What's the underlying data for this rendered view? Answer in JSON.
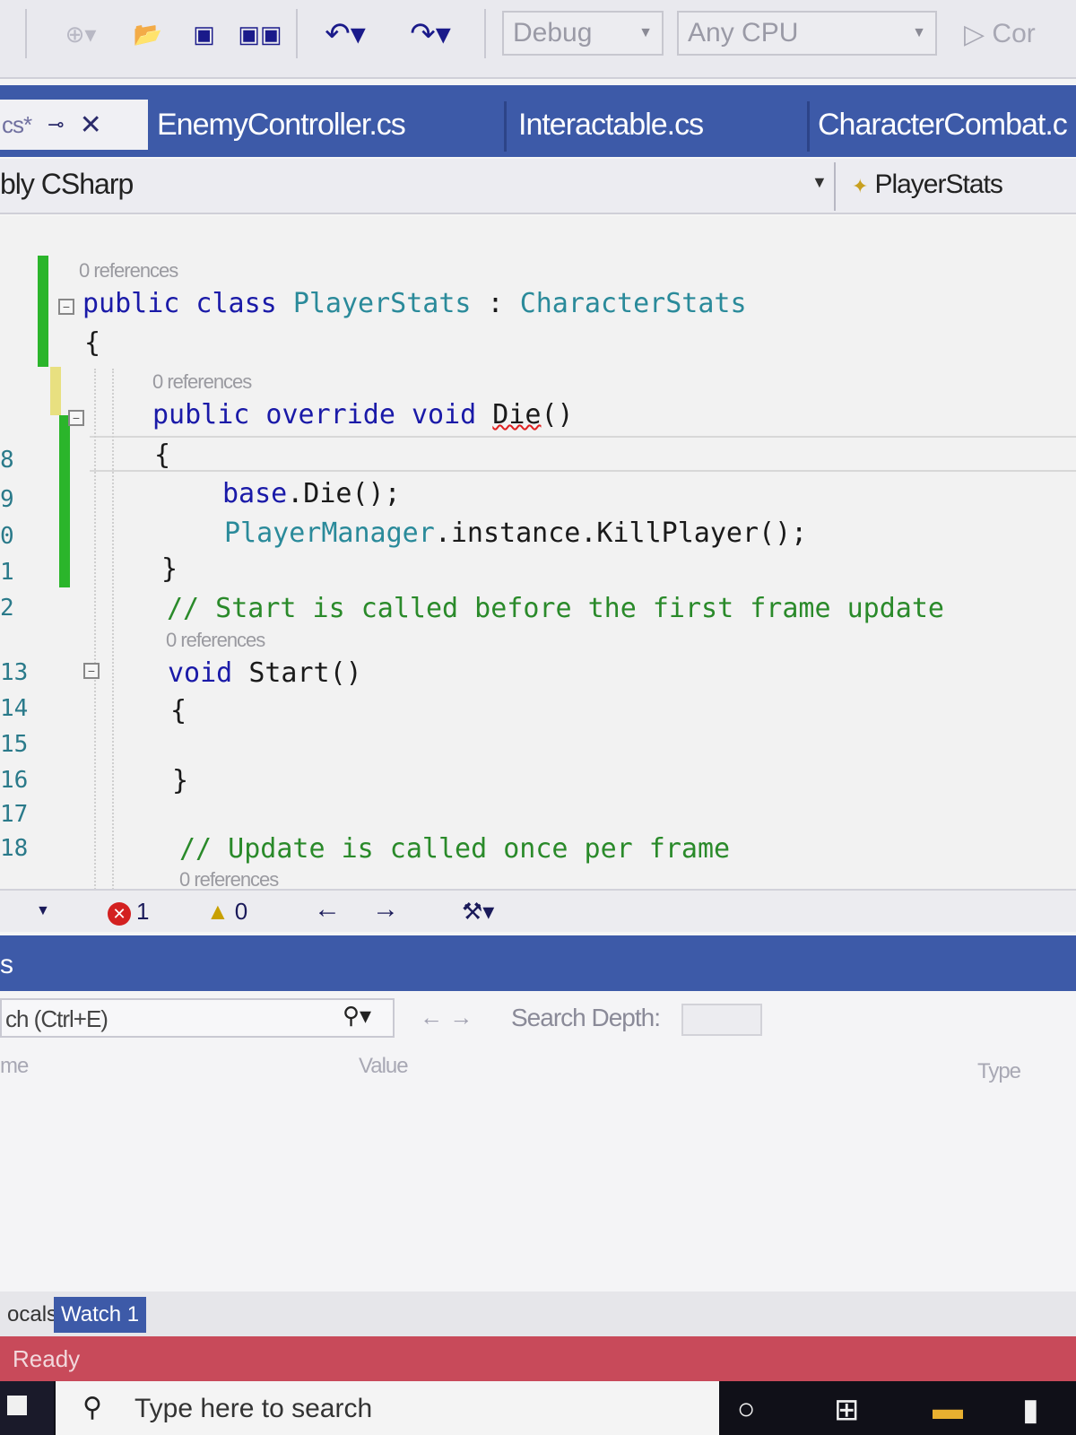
{
  "toolbar": {
    "debug_config": "Debug",
    "platform": "Any CPU",
    "continue_label": "Cor"
  },
  "tabs": [
    {
      "label": "cs*",
      "active": true
    },
    {
      "label": "EnemyController.cs",
      "active": false
    },
    {
      "label": "Interactable.cs",
      "active": false
    },
    {
      "label": "CharacterCombat.c",
      "active": false
    }
  ],
  "navbar": {
    "project": "bly CSharp",
    "member": "PlayerStats"
  },
  "editor": {
    "codelens": "0 references",
    "lines": {
      "class_decl_kw": "public class",
      "class_name": "PlayerStats",
      "class_colon": " : ",
      "class_base": "CharacterStats",
      "open_brace": "{",
      "die_kw": "public override void",
      "die_name": "Die",
      "die_parens": "()",
      "base_die_kw": "base",
      "base_die_rest": ".Die();",
      "kill_type": "PlayerManager",
      "kill_rest": ".instance.KillPlayer();",
      "close_brace": "}",
      "comment_start": "// Start is called before the first frame update",
      "start_kw": "void",
      "start_name": "Start",
      "start_parens": "()",
      "comment_update": "// Update is called once per frame"
    },
    "line_numbers": [
      "8",
      "9",
      "0",
      "1",
      "2",
      "13",
      "14",
      "15",
      "16",
      "17",
      "18"
    ]
  },
  "status_strip": {
    "errors": "1",
    "warnings": "0"
  },
  "watch": {
    "panel_title": "s",
    "search_placeholder": "ch (Ctrl+E)",
    "search_depth_label": "Search Depth:",
    "columns": [
      "me",
      "Value",
      "Type"
    ],
    "tabs": [
      {
        "label": "ocals",
        "active": false
      },
      {
        "label": "Watch 1",
        "active": true
      }
    ]
  },
  "vs_status": "Ready",
  "taskbar": {
    "search_placeholder": "Type here to search"
  }
}
